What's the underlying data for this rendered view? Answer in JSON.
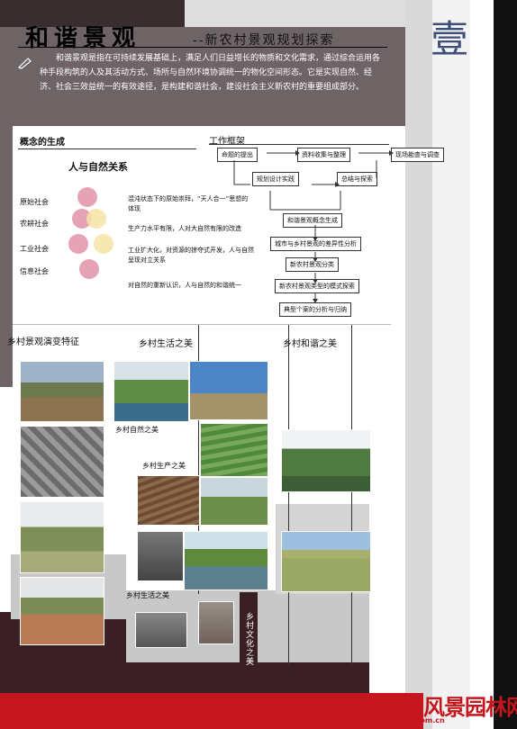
{
  "header": {
    "title": "和谐景观",
    "subtitle": "--新农村景观规划探索",
    "number": "壹"
  },
  "intro": {
    "text": "和谐景观是指在可持续发展基础上，满足人们日益增长的物质和文化需求，通过综合运用各种手段构筑的人及其活动方式、场所与自然环境协调统一的物化空间形态。它是实现自然、经济、社会三效益统一的有效途径，是构建和谐社会，建设社会主义新农村的重要组成部分。"
  },
  "concept": {
    "heading": "概念的生成",
    "subheading": "人与自然关系",
    "stages": [
      {
        "label": "原始社会",
        "desc": "混沌状态下的原始崇拜，“天人合一”思想的体现"
      },
      {
        "label": "农耕社会",
        "desc": "生产力水平有限，人对大自然有限的改造"
      },
      {
        "label": "工业社会",
        "desc": "工业扩大化，对资源的掠夺式开发，人与自然呈现对立关系"
      },
      {
        "label": "信息社会",
        "desc": "对自然的重新认识，人与自然的和谐统一"
      }
    ]
  },
  "framework": {
    "heading": "工作框架",
    "nodes": {
      "propose": "命题的提出",
      "collect": "资料收集与整理",
      "survey": "现场勘查与调查",
      "design": "规划设计实践",
      "summary": "总结与探索",
      "concept": "和谐景观概念生成",
      "difference": "城市与乡村景观的差异性分析",
      "classify": "新农村景观分类",
      "pattern": "新农村景观类型的模式探索",
      "case": "典型个案的分析与归纳"
    }
  },
  "sections": {
    "evolution": "乡村景观演变特征",
    "life": "乡村生活之美",
    "harmony": "乡村和谐之美",
    "nature": "乡村自然之美",
    "production": "乡村生产之美",
    "living": "乡村生活之美",
    "culture": "乡村文化之美"
  },
  "watermark": {
    "brand": "中国风景园林网",
    "url": "chla.com.cn"
  },
  "colors": {
    "accent_red": "#c4161c",
    "number_blue": "#3d4f77",
    "circle_pink": "#e7a3b6",
    "circle_yellow": "#f4e3a6"
  }
}
